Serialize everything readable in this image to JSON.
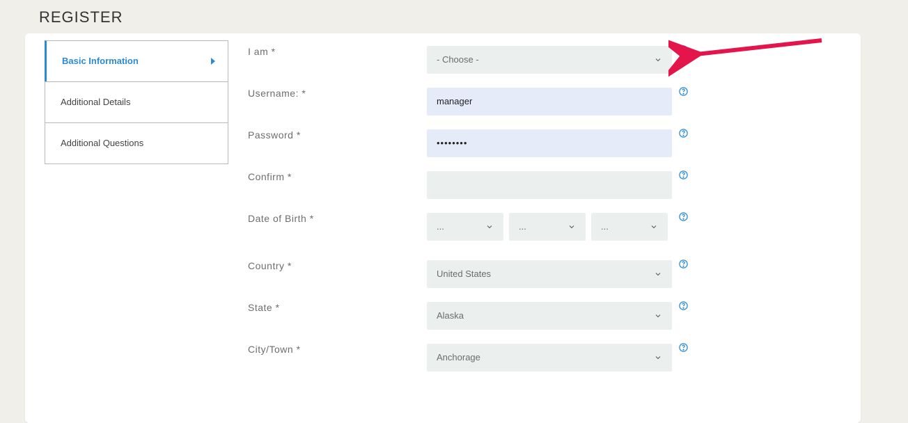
{
  "page": {
    "title": "REGISTER"
  },
  "tabs": {
    "items": [
      {
        "label": "Basic Information"
      },
      {
        "label": "Additional Details"
      },
      {
        "label": "Additional Questions"
      }
    ]
  },
  "form": {
    "iam": {
      "label": "I am *",
      "value": "- Choose -"
    },
    "username": {
      "label": "Username: *",
      "value": "manager"
    },
    "password": {
      "label": "Password *",
      "value": "••••••••"
    },
    "confirm": {
      "label": "Confirm *",
      "value": ""
    },
    "dob": {
      "label": "Date of Birth *",
      "day": "...",
      "month": "...",
      "year": "..."
    },
    "country": {
      "label": "Country *",
      "value": "United States"
    },
    "state": {
      "label": "State *",
      "value": "Alaska"
    },
    "city": {
      "label": "City/Town *",
      "value": "Anchorage"
    }
  }
}
